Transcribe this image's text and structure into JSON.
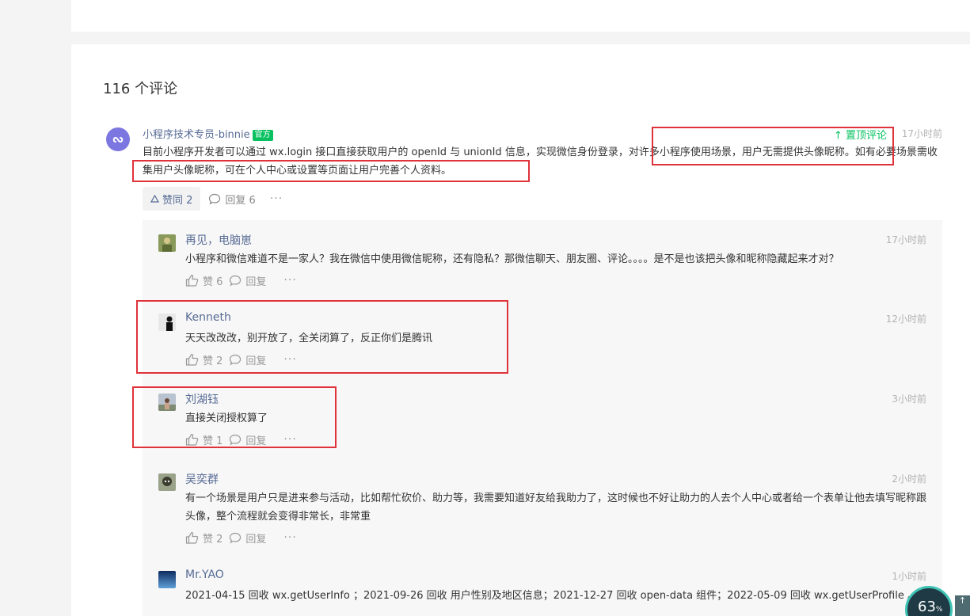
{
  "comments_section": {
    "count_label": "116 个评论"
  },
  "top_comment": {
    "author": "小程序技术专员-binnie",
    "badge": "官方",
    "pin_label": "置顶评论",
    "time": "17小时前",
    "body": "目前小程序开发者可以通过 wx.login 接口直接获取用户的 openId 与 unionId 信息，实现微信身份登录，对许多小程序使用场景，用户无需提供头像昵称。如有必要场景需收集用户头像昵称，可在个人中心或设置等页面让用户完善个人资料。",
    "like_label": "赞同 2",
    "reply_label": "回复 6"
  },
  "replies": [
    {
      "author": "再见，电脑崽",
      "time": "17小时前",
      "body": "小程序和微信难道不是一家人？我在微信中使用微信昵称，还有隐私？那微信聊天、朋友圈、评论。。。。是不是也该把头像和昵称隐藏起来才对？",
      "like_label": "赞 6",
      "reply_label": "回复"
    },
    {
      "author": "Kenneth",
      "time": "12小时前",
      "body": "天天改改改，别开放了，全关闭算了，反正你们是腾讯",
      "like_label": "赞 2",
      "reply_label": "回复"
    },
    {
      "author": "刘湖钰",
      "time": "3小时前",
      "body": "直接关闭授权算了",
      "like_label": "赞 1",
      "reply_label": "回复"
    },
    {
      "author": "吴奕群",
      "time": "2小时前",
      "body": "有一个场景是用户只是进来参与活动，比如帮忙砍价、助力等，我需要知道好友给我助力了，这时候也不好让助力的人去个人中心或者给一个表单让他去填写昵称跟头像，整个流程就会变得非常长，非常重",
      "like_label": "赞 2",
      "reply_label": "回复"
    },
    {
      "author": "Mr.YAO",
      "time": "1小时前",
      "body": "2021-04-15 回收 wx.getUserInfo ；2021-09-26 回收 用户性别及地区信息；2021-12-27 回收 open-data 组件；2022-05-09 回收 wx.getUserProfile 。"
    }
  ],
  "overlay": {
    "percent": "63",
    "percent_unit": "%",
    "scroll_arrow": "↑"
  },
  "icons": {
    "like": "thumb-up-icon",
    "reply": "comment-bubble-icon",
    "more": "more-dots-icon",
    "pin": "arrow-up-icon"
  },
  "colors": {
    "link": "#576b95",
    "official_badge": "#07c160",
    "highlight_box": "#e0323a"
  }
}
